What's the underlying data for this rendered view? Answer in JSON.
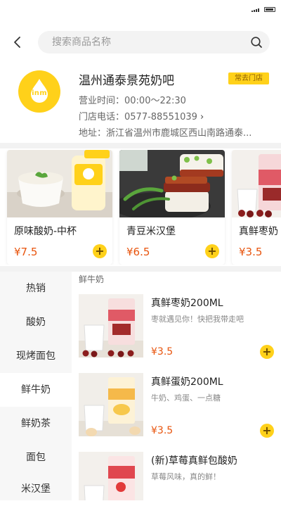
{
  "search": {
    "placeholder": "搜索商品名称"
  },
  "store": {
    "logo_text": "inm",
    "name": "温州通泰景苑奶吧",
    "badge": "常去门店",
    "hours": "营业时间：00:00～22:30",
    "phone": "门店电话：0577-88551039",
    "address": "地址：浙江省温州市鹿城区西山南路通泰..."
  },
  "featured": [
    {
      "name": "原味酸奶-中杯",
      "price": "¥7.5"
    },
    {
      "name": "青豆米汉堡",
      "price": "¥6.5"
    },
    {
      "name": "真鲜枣奶",
      "price": "¥3.5"
    }
  ],
  "categories": [
    "热销",
    "酸奶",
    "现烤面包",
    "鲜牛奶",
    "鲜奶茶",
    "面包",
    "米汉堡"
  ],
  "active_category": "鲜牛奶",
  "section": {
    "title": "鲜牛奶"
  },
  "products": [
    {
      "name": "真鲜枣奶200ML",
      "desc": "枣就遇见你！快把我带走吧",
      "price": "¥3.5"
    },
    {
      "name": "真鲜蛋奶200ML",
      "desc": "牛奶、鸡蛋、一点糖",
      "price": "¥3.5"
    },
    {
      "name": "(新)草莓真鲜包酸奶",
      "desc": "草莓风味，真的鲜！",
      "price": ""
    }
  ],
  "add_symbol": "+",
  "colors": {
    "accent": "#ffd11a",
    "price": "#e8540d",
    "sidebar_bg": "#f7f7f7"
  }
}
